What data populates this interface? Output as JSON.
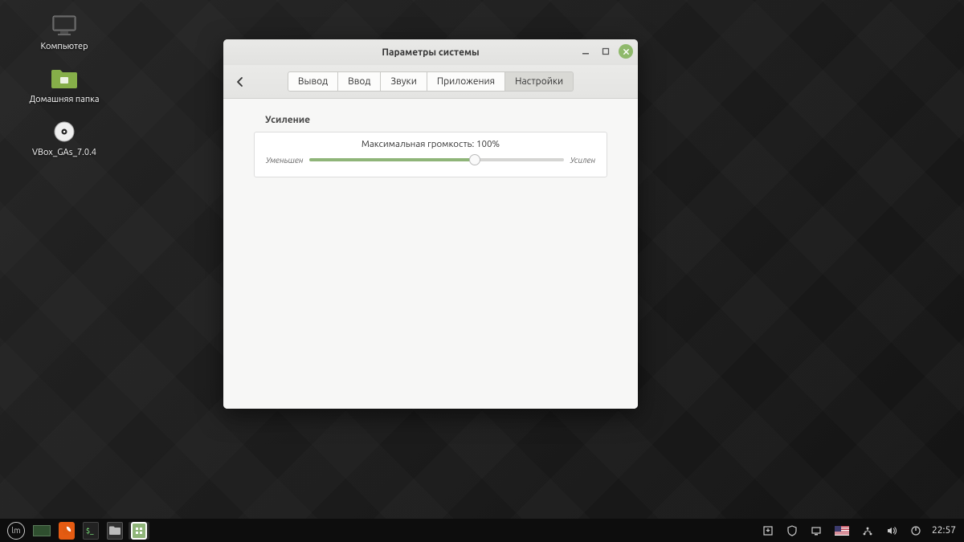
{
  "desktop": {
    "icons": [
      {
        "label": "Компьютер"
      },
      {
        "label": "Домашняя папка"
      },
      {
        "label": "VBox_GAs_7.0.4"
      }
    ]
  },
  "window": {
    "title": "Параметры системы",
    "tabs": [
      "Вывод",
      "Ввод",
      "Звуки",
      "Приложения",
      "Настройки"
    ],
    "active_tab": 4,
    "section": {
      "group": "Усиление",
      "max_label": "Максимальная громкость: 100%",
      "min_hint": "Уменьшен",
      "max_hint": "Усилен",
      "percent": 65
    }
  },
  "taskbar": {
    "clock": "22:57"
  }
}
